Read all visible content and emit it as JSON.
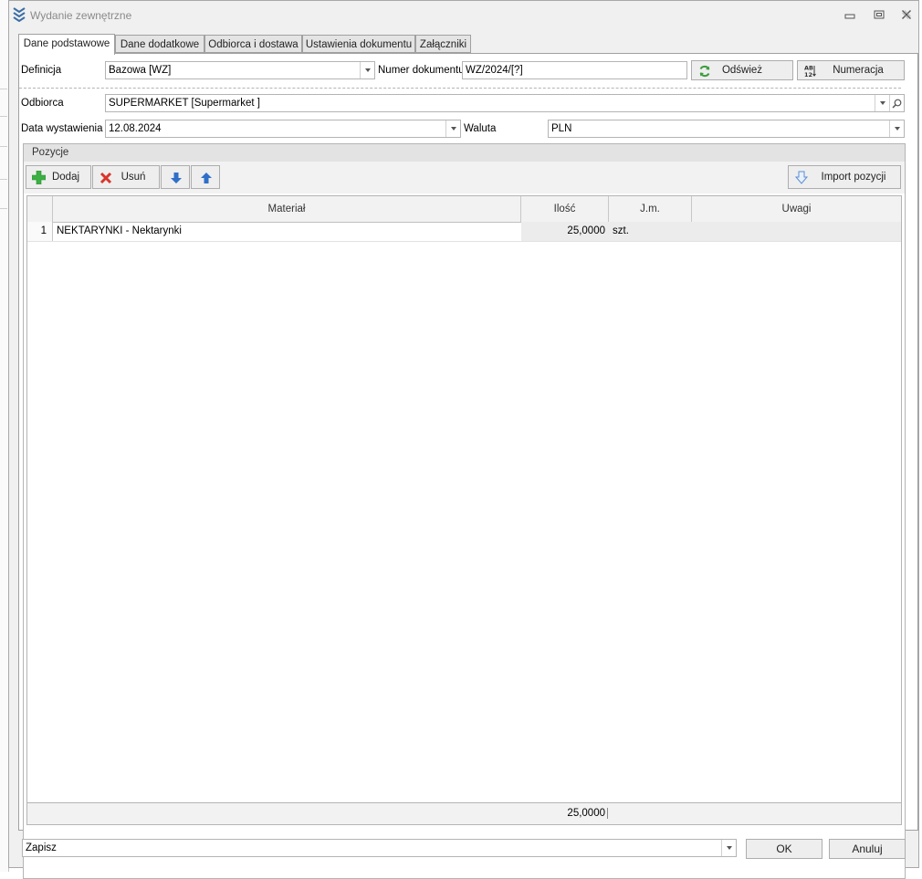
{
  "window": {
    "title": "Wydanie zewnętrzne",
    "icon": "app-chevrons-icon",
    "controls": [
      "minimize-icon",
      "maximize-icon",
      "close-icon"
    ]
  },
  "tabs": [
    {
      "label": "Dane podstawowe",
      "active": true
    },
    {
      "label": "Dane dodatkowe",
      "active": false
    },
    {
      "label": "Odbiorca i dostawa",
      "active": false
    },
    {
      "label": "Ustawienia dokumentu",
      "active": false
    },
    {
      "label": "Załączniki",
      "active": false
    }
  ],
  "form": {
    "definition_label": "Definicja",
    "definition_value": "Bazowa [WZ]",
    "doc_number_label": "Numer dokumentu",
    "doc_number_value": "WZ/2024/[?]",
    "refresh_label": "Odśwież",
    "numbering_label": "Numeracja",
    "recipient_label": "Odbiorca",
    "recipient_value": "SUPERMARKET [Supermarket    ]",
    "issue_date_label": "Data wystawienia",
    "issue_date_value": "12.08.2024",
    "currency_label": "Waluta",
    "currency_value": "PLN"
  },
  "positions": {
    "group_title": "Pozycje",
    "add_label": "Dodaj",
    "remove_label": "Usuń",
    "import_label": "Import pozycji",
    "columns": {
      "material": "Materiał",
      "quantity": "Ilość",
      "unit": "J.m.",
      "notes": "Uwagi"
    },
    "rows": [
      {
        "index": "1",
        "material": "NEKTARYNKI - Nektarynki",
        "quantity": "25,0000",
        "unit": "szt.",
        "notes": ""
      }
    ],
    "total_quantity": "25,0000"
  },
  "footer": {
    "action_value": "Zapisz",
    "ok_label": "OK",
    "cancel_label": "Anuluj"
  },
  "colors": {
    "add_icon": "#3cb043",
    "remove_icon": "#d9342b",
    "arrow_icon": "#2f6fc9",
    "refresh_icon": "#3a9c3a"
  }
}
